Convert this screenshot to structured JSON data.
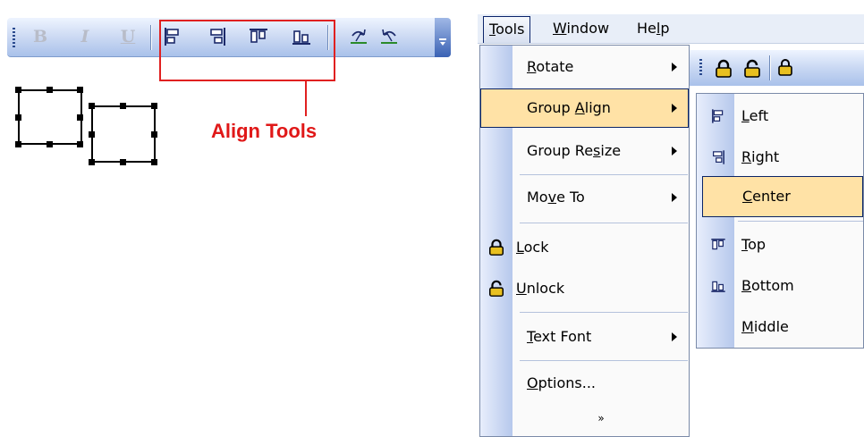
{
  "left_toolbar": {
    "bold_label": "B",
    "italic_label": "I",
    "underline_label": "U",
    "icons": [
      "align-left-icon",
      "align-right-icon",
      "align-top-icon",
      "align-bottom-icon",
      "rotate-right-icon",
      "rotate-left-icon"
    ]
  },
  "callout": {
    "text": "Align Tools",
    "color": "#e01818"
  },
  "menubar": {
    "items": [
      {
        "label": "Tools",
        "accel": "T"
      },
      {
        "label": "Window",
        "accel": "W"
      },
      {
        "label": "Help",
        "accel": "l"
      }
    ]
  },
  "tools_menu": {
    "items": [
      {
        "label": "Rotate",
        "accel": "R",
        "submenu": true
      },
      {
        "label": "Group Align",
        "accel": "A",
        "submenu": true,
        "highlighted": true
      },
      {
        "label": "Group Resize",
        "accel": "s",
        "submenu": true
      },
      {
        "label": "Move To",
        "accel": "v",
        "submenu": true
      },
      {
        "label": "Lock",
        "accel": "L",
        "icon": "lock-icon"
      },
      {
        "label": "Unlock",
        "accel": "U",
        "icon": "unlock-icon"
      },
      {
        "label": "Text Font",
        "accel": "T",
        "submenu": true
      },
      {
        "label": "Options...",
        "accel": "O"
      }
    ]
  },
  "group_align_submenu": {
    "items": [
      {
        "label": "Left",
        "accel": "L",
        "icon": "align-left-icon"
      },
      {
        "label": "Right",
        "accel": "R",
        "icon": "align-right-icon"
      },
      {
        "label": "Center",
        "accel": "C",
        "highlighted": true
      },
      {
        "label": "Top",
        "accel": "T",
        "icon": "align-top-icon"
      },
      {
        "label": "Bottom",
        "accel": "B",
        "icon": "align-bottom-icon"
      },
      {
        "label": "Middle",
        "accel": "M"
      }
    ]
  },
  "colors": {
    "menu_highlight": "#ffe2a6",
    "highlight_border": "#0a2466",
    "toolbar_blue": "#a9c1ea"
  }
}
